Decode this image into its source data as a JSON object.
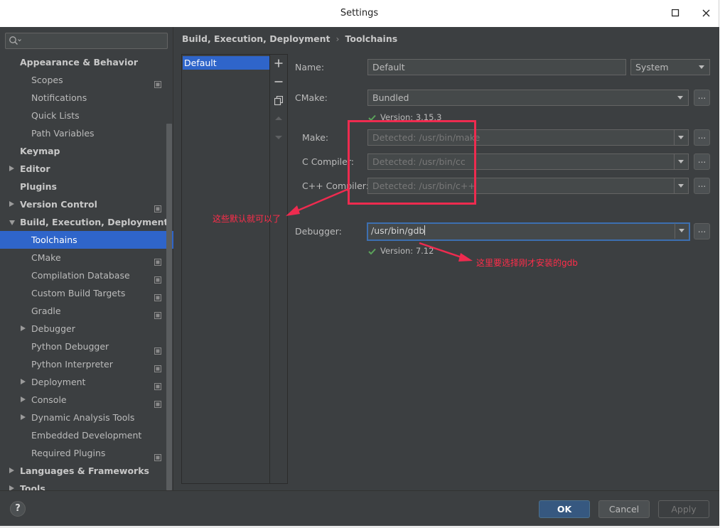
{
  "window": {
    "title": "Settings"
  },
  "breadcrumb": {
    "parent": "Build, Execution, Deployment",
    "separator": "›",
    "current": "Toolchains"
  },
  "sidebar": {
    "items": [
      {
        "label": "Appearance & Behavior",
        "level": 0,
        "bold": true,
        "expand": "none"
      },
      {
        "label": "Scopes",
        "level": 1,
        "cfg": true,
        "expand": "none"
      },
      {
        "label": "Notifications",
        "level": 1,
        "expand": "none"
      },
      {
        "label": "Quick Lists",
        "level": 1,
        "expand": "none"
      },
      {
        "label": "Path Variables",
        "level": 1,
        "expand": "none"
      },
      {
        "label": "Keymap",
        "level": 0,
        "bold": true,
        "expand": "none"
      },
      {
        "label": "Editor",
        "level": 0,
        "bold": true,
        "expand": "right"
      },
      {
        "label": "Plugins",
        "level": 0,
        "bold": true,
        "expand": "none"
      },
      {
        "label": "Version Control",
        "level": 0,
        "bold": true,
        "cfg": true,
        "expand": "right"
      },
      {
        "label": "Build, Execution, Deployment",
        "level": 0,
        "bold": true,
        "expand": "down"
      },
      {
        "label": "Toolchains",
        "level": 1,
        "selected": true,
        "expand": "none"
      },
      {
        "label": "CMake",
        "level": 1,
        "cfg": true,
        "expand": "none"
      },
      {
        "label": "Compilation Database",
        "level": 1,
        "cfg": true,
        "expand": "none"
      },
      {
        "label": "Custom Build Targets",
        "level": 1,
        "cfg": true,
        "expand": "none"
      },
      {
        "label": "Gradle",
        "level": 1,
        "cfg": true,
        "expand": "none"
      },
      {
        "label": "Debugger",
        "level": 1,
        "expand": "right"
      },
      {
        "label": "Python Debugger",
        "level": 1,
        "cfg": true,
        "expand": "none"
      },
      {
        "label": "Python Interpreter",
        "level": 1,
        "cfg": true,
        "expand": "none"
      },
      {
        "label": "Deployment",
        "level": 1,
        "cfg": true,
        "expand": "right"
      },
      {
        "label": "Console",
        "level": 1,
        "cfg": true,
        "expand": "right"
      },
      {
        "label": "Dynamic Analysis Tools",
        "level": 1,
        "expand": "right"
      },
      {
        "label": "Embedded Development",
        "level": 1,
        "expand": "none"
      },
      {
        "label": "Required Plugins",
        "level": 1,
        "cfg": true,
        "expand": "none"
      },
      {
        "label": "Languages & Frameworks",
        "level": 0,
        "bold": true,
        "expand": "right"
      },
      {
        "label": "Tools",
        "level": 0,
        "bold": true,
        "expand": "right"
      }
    ]
  },
  "toolchains": {
    "list": [
      "Default"
    ]
  },
  "form": {
    "name_label": "Name:",
    "name_value": "Default",
    "type_value": "System",
    "cmake_label": "CMake:",
    "cmake_value": "Bundled",
    "cmake_version": "Version: 3.15.3",
    "make_label": "Make:",
    "make_value": "Detected: /usr/bin/make",
    "cc_label": "C Compiler:",
    "cc_value": "Detected: /usr/bin/cc",
    "cxx_label": "C++ Compiler:",
    "cxx_value": "Detected: /usr/bin/c++",
    "debugger_label": "Debugger:",
    "debugger_value": "/usr/bin/gdb",
    "debugger_version": "Version: 7.12",
    "browse": "..."
  },
  "annotations": {
    "defaults_note": "这些默认就可以了",
    "gdb_note": "这里要选择刚才安装的gdb",
    "color": "#ff2d4a"
  },
  "footer": {
    "help": "?",
    "ok": "OK",
    "cancel": "Cancel",
    "apply": "Apply"
  },
  "colors": {
    "accent": "#2f65ca",
    "background": "#3c3f41",
    "ok_button": "#365880"
  }
}
